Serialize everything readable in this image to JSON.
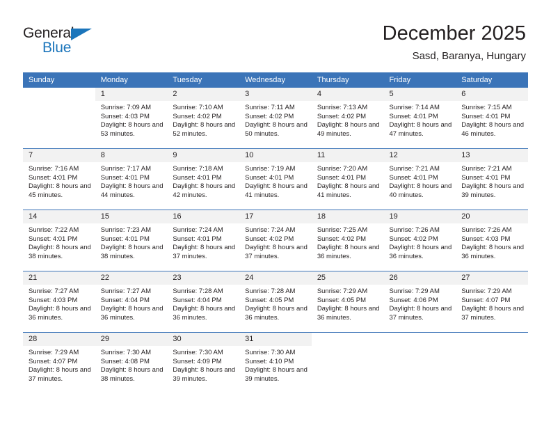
{
  "brand": {
    "name_top": "General",
    "name_bottom": "Blue",
    "triangle_color": "#1b75bb",
    "text_color": "#231f20"
  },
  "header": {
    "month_title": "December 2025",
    "location": "Sasd, Baranya, Hungary"
  },
  "theme": {
    "header_blue": "#3b74b8",
    "daynum_band": "#f2f2f2",
    "text": "#231f20",
    "cell_bg": "#ffffff"
  },
  "weekday_headers": [
    "Sunday",
    "Monday",
    "Tuesday",
    "Wednesday",
    "Thursday",
    "Friday",
    "Saturday"
  ],
  "labels": {
    "sunrise_prefix": "Sunrise:",
    "sunset_prefix": "Sunset:",
    "daylight_prefix": "Daylight:"
  },
  "weeks": [
    [
      {
        "empty": true
      },
      {
        "day": "1",
        "sunrise": "Sunrise: 7:09 AM",
        "sunset": "Sunset: 4:03 PM",
        "daylight": "Daylight: 8 hours and 53 minutes."
      },
      {
        "day": "2",
        "sunrise": "Sunrise: 7:10 AM",
        "sunset": "Sunset: 4:02 PM",
        "daylight": "Daylight: 8 hours and 52 minutes."
      },
      {
        "day": "3",
        "sunrise": "Sunrise: 7:11 AM",
        "sunset": "Sunset: 4:02 PM",
        "daylight": "Daylight: 8 hours and 50 minutes."
      },
      {
        "day": "4",
        "sunrise": "Sunrise: 7:13 AM",
        "sunset": "Sunset: 4:02 PM",
        "daylight": "Daylight: 8 hours and 49 minutes."
      },
      {
        "day": "5",
        "sunrise": "Sunrise: 7:14 AM",
        "sunset": "Sunset: 4:01 PM",
        "daylight": "Daylight: 8 hours and 47 minutes."
      },
      {
        "day": "6",
        "sunrise": "Sunrise: 7:15 AM",
        "sunset": "Sunset: 4:01 PM",
        "daylight": "Daylight: 8 hours and 46 minutes."
      }
    ],
    [
      {
        "day": "7",
        "sunrise": "Sunrise: 7:16 AM",
        "sunset": "Sunset: 4:01 PM",
        "daylight": "Daylight: 8 hours and 45 minutes."
      },
      {
        "day": "8",
        "sunrise": "Sunrise: 7:17 AM",
        "sunset": "Sunset: 4:01 PM",
        "daylight": "Daylight: 8 hours and 44 minutes."
      },
      {
        "day": "9",
        "sunrise": "Sunrise: 7:18 AM",
        "sunset": "Sunset: 4:01 PM",
        "daylight": "Daylight: 8 hours and 42 minutes."
      },
      {
        "day": "10",
        "sunrise": "Sunrise: 7:19 AM",
        "sunset": "Sunset: 4:01 PM",
        "daylight": "Daylight: 8 hours and 41 minutes."
      },
      {
        "day": "11",
        "sunrise": "Sunrise: 7:20 AM",
        "sunset": "Sunset: 4:01 PM",
        "daylight": "Daylight: 8 hours and 41 minutes."
      },
      {
        "day": "12",
        "sunrise": "Sunrise: 7:21 AM",
        "sunset": "Sunset: 4:01 PM",
        "daylight": "Daylight: 8 hours and 40 minutes."
      },
      {
        "day": "13",
        "sunrise": "Sunrise: 7:21 AM",
        "sunset": "Sunset: 4:01 PM",
        "daylight": "Daylight: 8 hours and 39 minutes."
      }
    ],
    [
      {
        "day": "14",
        "sunrise": "Sunrise: 7:22 AM",
        "sunset": "Sunset: 4:01 PM",
        "daylight": "Daylight: 8 hours and 38 minutes."
      },
      {
        "day": "15",
        "sunrise": "Sunrise: 7:23 AM",
        "sunset": "Sunset: 4:01 PM",
        "daylight": "Daylight: 8 hours and 38 minutes."
      },
      {
        "day": "16",
        "sunrise": "Sunrise: 7:24 AM",
        "sunset": "Sunset: 4:01 PM",
        "daylight": "Daylight: 8 hours and 37 minutes."
      },
      {
        "day": "17",
        "sunrise": "Sunrise: 7:24 AM",
        "sunset": "Sunset: 4:02 PM",
        "daylight": "Daylight: 8 hours and 37 minutes."
      },
      {
        "day": "18",
        "sunrise": "Sunrise: 7:25 AM",
        "sunset": "Sunset: 4:02 PM",
        "daylight": "Daylight: 8 hours and 36 minutes."
      },
      {
        "day": "19",
        "sunrise": "Sunrise: 7:26 AM",
        "sunset": "Sunset: 4:02 PM",
        "daylight": "Daylight: 8 hours and 36 minutes."
      },
      {
        "day": "20",
        "sunrise": "Sunrise: 7:26 AM",
        "sunset": "Sunset: 4:03 PM",
        "daylight": "Daylight: 8 hours and 36 minutes."
      }
    ],
    [
      {
        "day": "21",
        "sunrise": "Sunrise: 7:27 AM",
        "sunset": "Sunset: 4:03 PM",
        "daylight": "Daylight: 8 hours and 36 minutes."
      },
      {
        "day": "22",
        "sunrise": "Sunrise: 7:27 AM",
        "sunset": "Sunset: 4:04 PM",
        "daylight": "Daylight: 8 hours and 36 minutes."
      },
      {
        "day": "23",
        "sunrise": "Sunrise: 7:28 AM",
        "sunset": "Sunset: 4:04 PM",
        "daylight": "Daylight: 8 hours and 36 minutes."
      },
      {
        "day": "24",
        "sunrise": "Sunrise: 7:28 AM",
        "sunset": "Sunset: 4:05 PM",
        "daylight": "Daylight: 8 hours and 36 minutes."
      },
      {
        "day": "25",
        "sunrise": "Sunrise: 7:29 AM",
        "sunset": "Sunset: 4:05 PM",
        "daylight": "Daylight: 8 hours and 36 minutes."
      },
      {
        "day": "26",
        "sunrise": "Sunrise: 7:29 AM",
        "sunset": "Sunset: 4:06 PM",
        "daylight": "Daylight: 8 hours and 37 minutes."
      },
      {
        "day": "27",
        "sunrise": "Sunrise: 7:29 AM",
        "sunset": "Sunset: 4:07 PM",
        "daylight": "Daylight: 8 hours and 37 minutes."
      }
    ],
    [
      {
        "day": "28",
        "sunrise": "Sunrise: 7:29 AM",
        "sunset": "Sunset: 4:07 PM",
        "daylight": "Daylight: 8 hours and 37 minutes."
      },
      {
        "day": "29",
        "sunrise": "Sunrise: 7:30 AM",
        "sunset": "Sunset: 4:08 PM",
        "daylight": "Daylight: 8 hours and 38 minutes."
      },
      {
        "day": "30",
        "sunrise": "Sunrise: 7:30 AM",
        "sunset": "Sunset: 4:09 PM",
        "daylight": "Daylight: 8 hours and 39 minutes."
      },
      {
        "day": "31",
        "sunrise": "Sunrise: 7:30 AM",
        "sunset": "Sunset: 4:10 PM",
        "daylight": "Daylight: 8 hours and 39 minutes."
      },
      {
        "empty": true
      },
      {
        "empty": true
      },
      {
        "empty": true
      }
    ]
  ]
}
